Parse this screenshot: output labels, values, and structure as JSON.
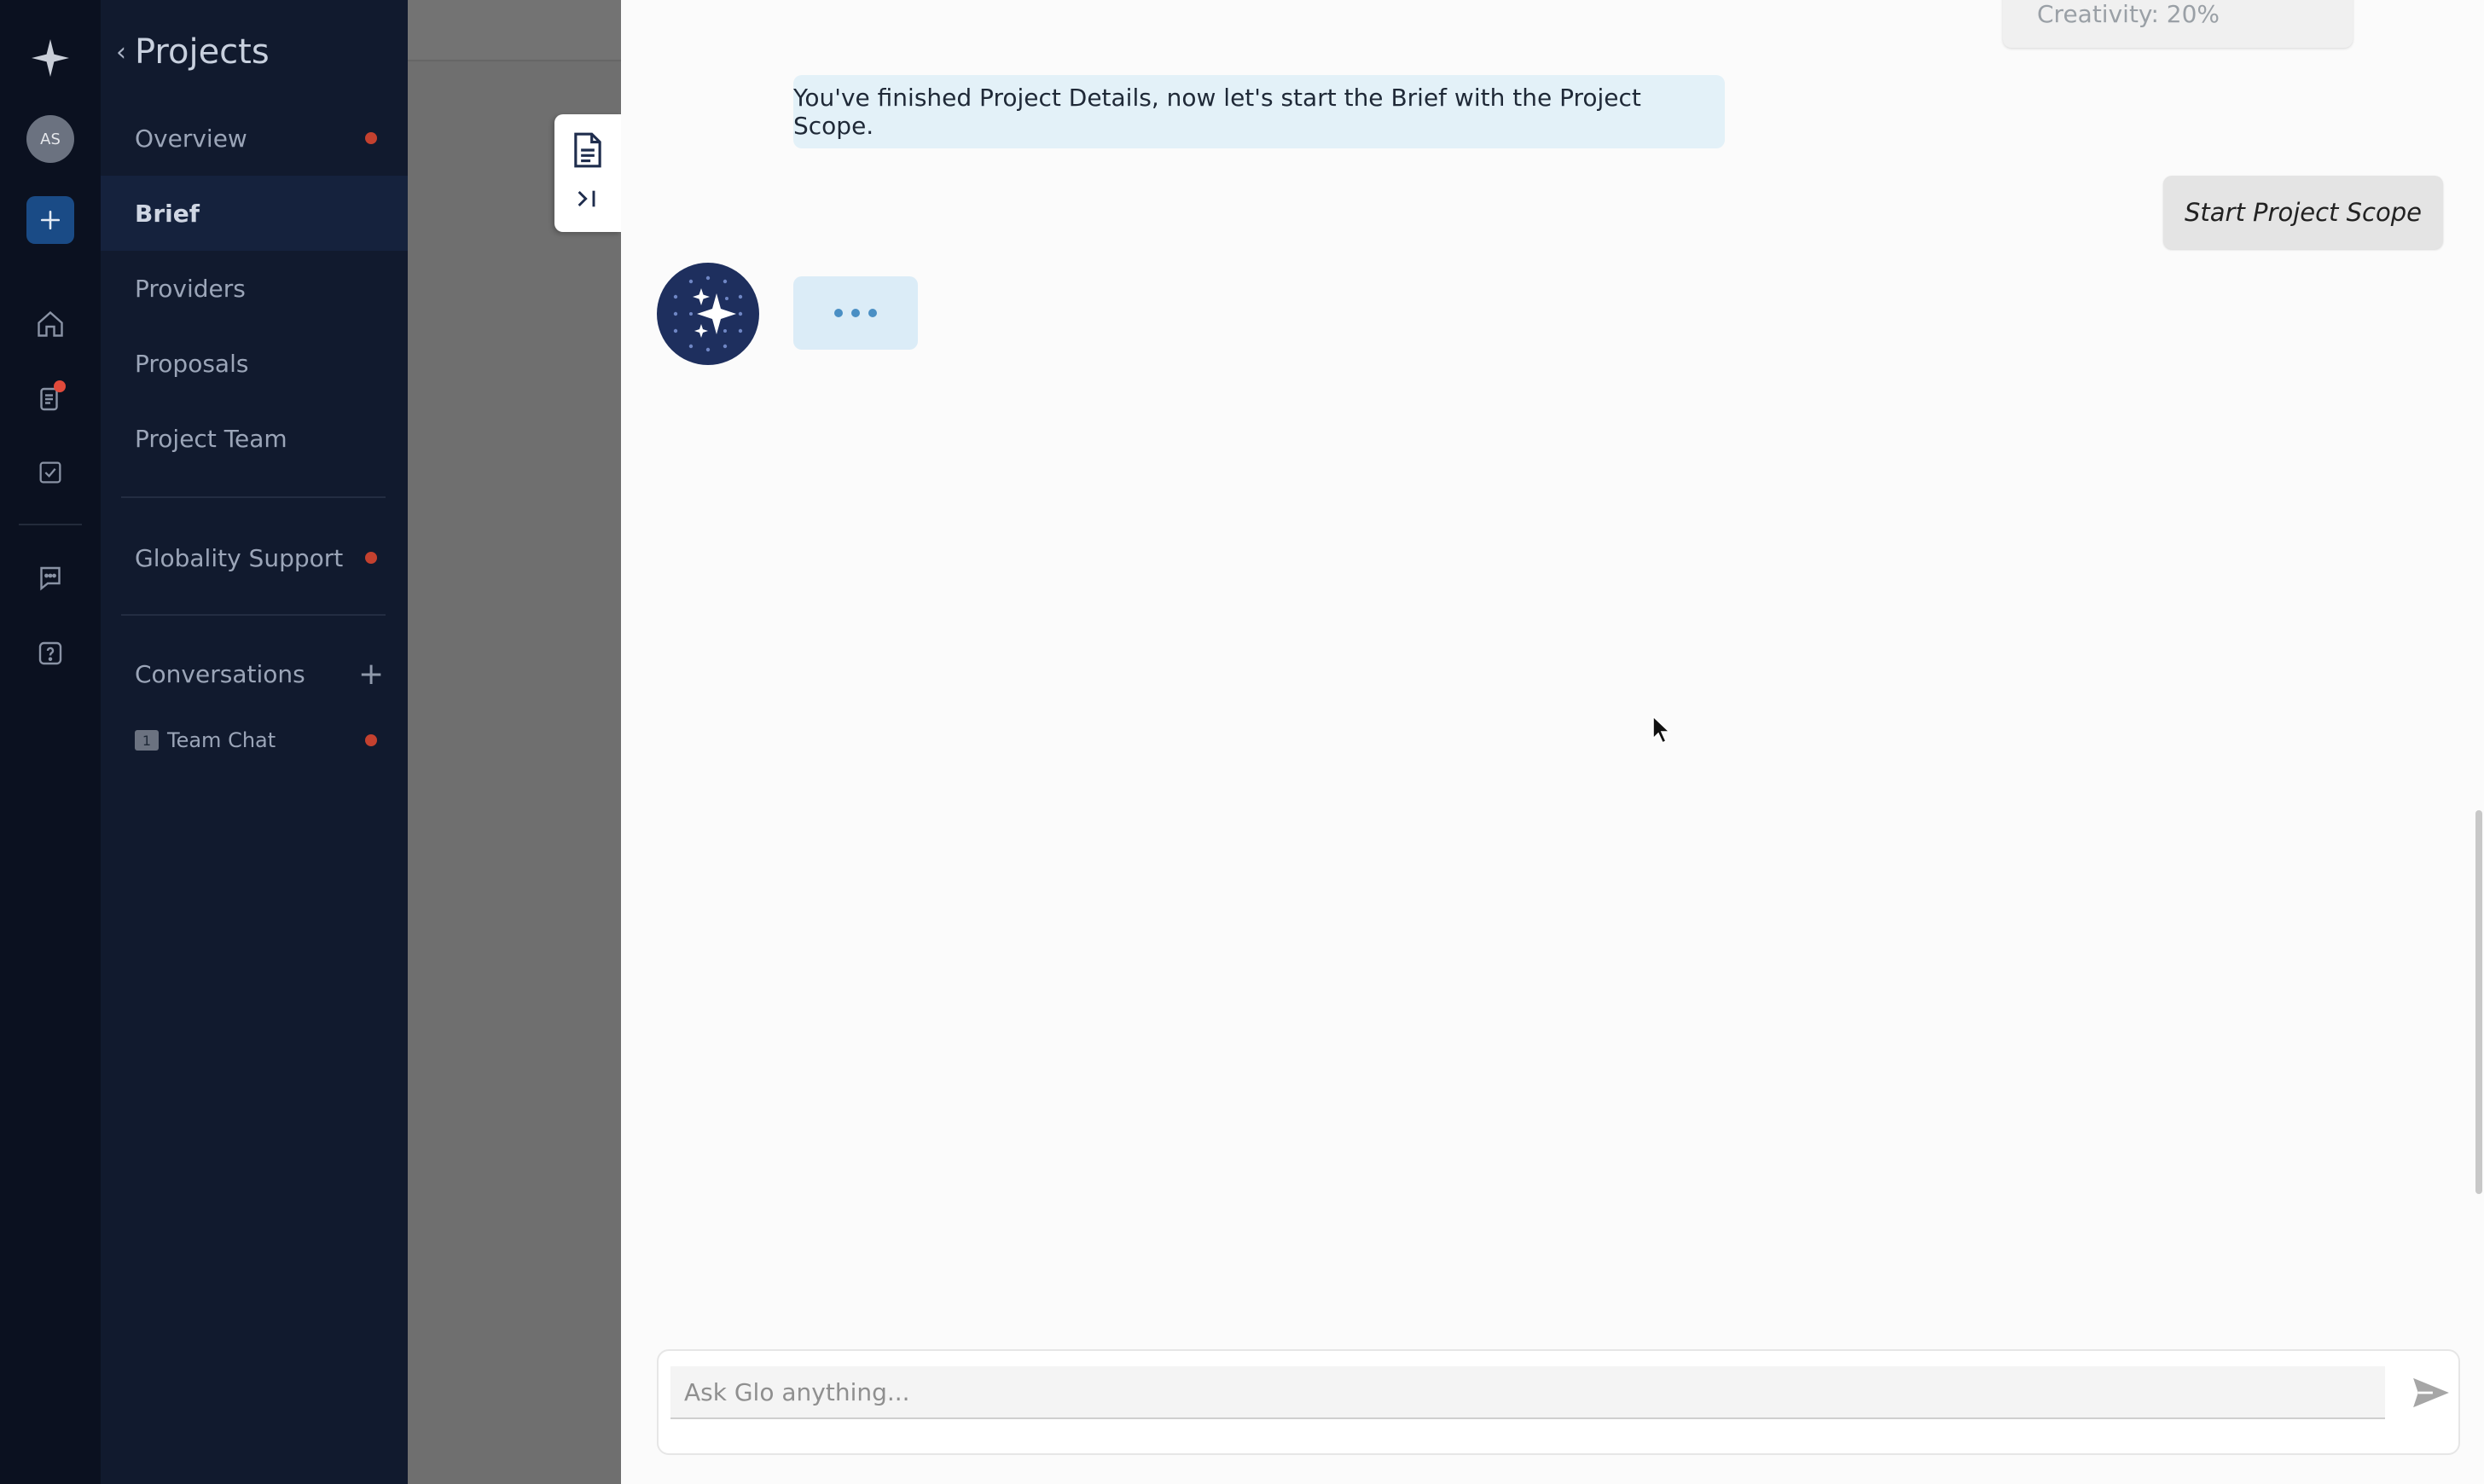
{
  "rail": {
    "avatar_initials": "AS",
    "icons": [
      "sparkle-logo-icon",
      "plus-icon",
      "home-icon",
      "documents-icon",
      "checklist-icon",
      "chat-icon",
      "help-icon"
    ]
  },
  "nav": {
    "title": "Projects",
    "items": [
      {
        "label": "Overview"
      },
      {
        "label": "Brief"
      },
      {
        "label": "Providers"
      },
      {
        "label": "Proposals"
      },
      {
        "label": "Project Team"
      }
    ],
    "support_label": "Globality Support",
    "conversations_label": "Conversations",
    "team_chat": {
      "badge": "1",
      "label": "Team Chat"
    }
  },
  "chat": {
    "previous_card_text": "Creativity: 20%",
    "bot_message": "You've finished Project Details, now let's start the Brief with the Project Scope.",
    "user_action_label": "Start Project Scope",
    "input_placeholder": "Ask Glo anything..."
  },
  "colors": {
    "rail_bg": "#0b1120",
    "nav_bg": "#111a2e",
    "accent_blue": "#1a4b86",
    "notification_red": "#c4412f",
    "bot_bubble": "#e3f1f8"
  }
}
